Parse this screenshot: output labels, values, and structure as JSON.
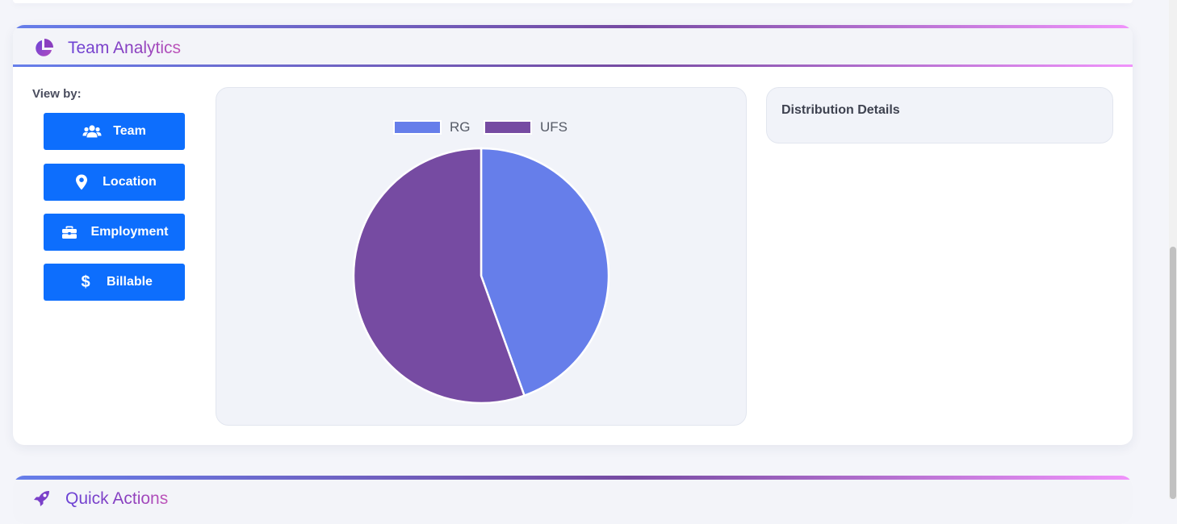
{
  "analytics": {
    "title": "Team Analytics",
    "icon": "chart-pie-icon",
    "view_by_label": "View by:",
    "buttons": [
      {
        "label": "Team",
        "icon": "users-icon"
      },
      {
        "label": "Location",
        "icon": "map-pin-icon"
      },
      {
        "label": "Employment",
        "icon": "briefcase-icon"
      },
      {
        "label": "Billable",
        "icon": "dollar-icon"
      }
    ],
    "button_color": "#0d6efd",
    "details_title": "Distribution Details"
  },
  "chart_data": {
    "type": "pie",
    "categories": [
      "RG",
      "UFS"
    ],
    "values": [
      44.5,
      55.5
    ],
    "colors": [
      "#667eea",
      "#764ba2"
    ],
    "legend_position": "top"
  },
  "quick_actions": {
    "title": "Quick Actions",
    "icon": "rocket-icon"
  },
  "colors": {
    "gradient_start": "#667eea",
    "gradient_mid": "#764ba2",
    "gradient_end": "#f093fb"
  }
}
